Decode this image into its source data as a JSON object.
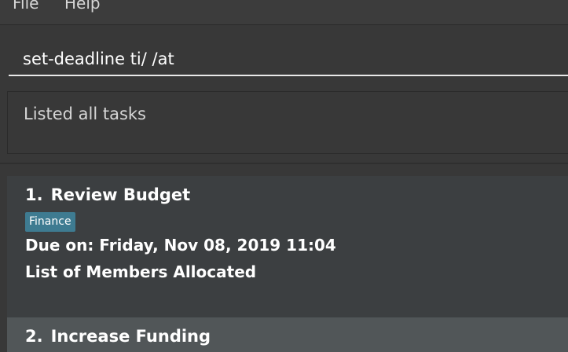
{
  "menu": {
    "items": [
      "File",
      "Help"
    ]
  },
  "command": {
    "value": "set-deadline ti/ /at"
  },
  "result": {
    "message": "Listed all tasks"
  },
  "tasks": [
    {
      "index": "1.",
      "name": "Review Budget",
      "tag": "Finance",
      "due": "Due on: Friday, Nov 08, 2019 11:04",
      "members_label": "List of Members Allocated"
    },
    {
      "index": "2.",
      "name": "Increase Funding"
    }
  ],
  "colors": {
    "background": "#383838",
    "card_odd": "#3c3f41",
    "card_even": "#515658",
    "tag": "#3e7b91",
    "text": "#ffffff",
    "muted_text": "#d6d6d6"
  }
}
